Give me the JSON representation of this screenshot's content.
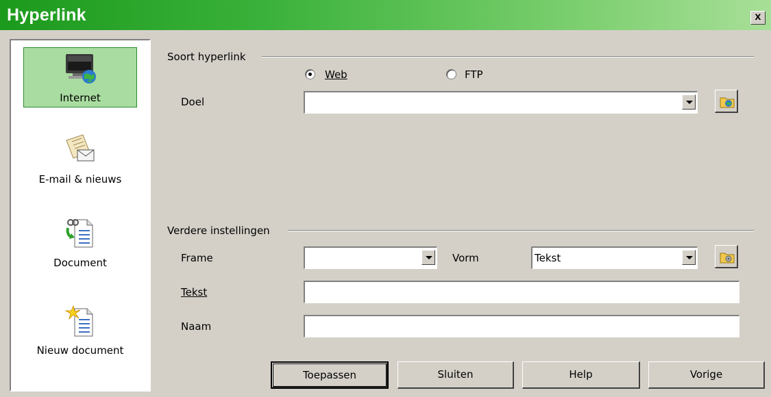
{
  "window": {
    "title": "Hyperlink",
    "close_label": "x"
  },
  "sidebar": {
    "items": [
      {
        "label": "Internet",
        "icon": "internet-icon",
        "selected": true
      },
      {
        "label": "E-mail & nieuws",
        "icon": "mail-icon",
        "selected": false
      },
      {
        "label": "Document",
        "icon": "document-icon",
        "selected": false
      },
      {
        "label": "Nieuw document",
        "icon": "new-document-icon",
        "selected": false
      }
    ]
  },
  "hyperlink_type": {
    "group_title": "Soort hyperlink",
    "options": [
      {
        "label": "Web",
        "checked": true
      },
      {
        "label": "FTP",
        "checked": false
      }
    ],
    "target_label": "Doel",
    "target_value": ""
  },
  "further_settings": {
    "group_title": "Verdere instellingen",
    "frame_label": "Frame",
    "frame_value": "",
    "form_label": "Vorm",
    "form_value": "Tekst",
    "text_label": "Tekst",
    "text_value": "",
    "name_label": "Naam",
    "name_value": ""
  },
  "buttons": {
    "apply": "Toepassen",
    "close": "Sluiten",
    "help": "Help",
    "previous": "Vorige"
  },
  "colors": {
    "title_gradient_start": "#1c9a1c",
    "title_gradient_end": "#a8df98",
    "selected_item_bg": "#a9dca0",
    "dialog_bg": "#d4d0c8"
  }
}
